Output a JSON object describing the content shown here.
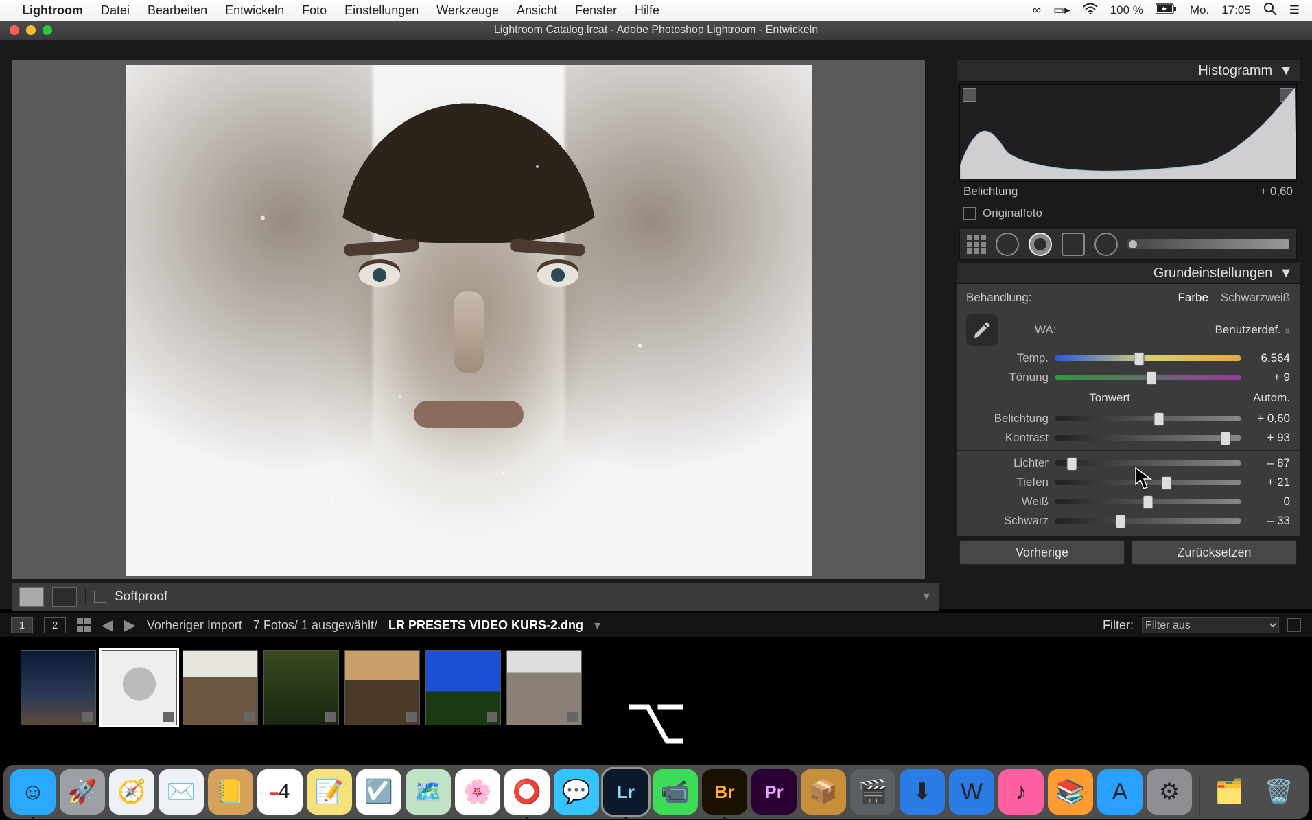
{
  "menubar": {
    "app": "Lightroom",
    "items": [
      "Datei",
      "Bearbeiten",
      "Entwickeln",
      "Foto",
      "Einstellungen",
      "Werkzeuge",
      "Ansicht",
      "Fenster",
      "Hilfe"
    ],
    "battery": "100 %",
    "day": "Mo.",
    "time": "17:05",
    "cc_icon": "creative-cloud",
    "airplay": "airplay",
    "wifi": "wifi",
    "search": "search",
    "menu": "menu"
  },
  "window": {
    "title": "Lightroom Catalog.lrcat - Adobe Photoshop Lightroom - Entwickeln"
  },
  "histogram": {
    "title": "Histogramm",
    "readout_label": "Belichtung",
    "readout_value": "+ 0,60",
    "original_label": "Originalfoto",
    "original_checked": false
  },
  "basic": {
    "title": "Grundeinstellungen",
    "treatment_label": "Behandlung:",
    "treatment_color": "Farbe",
    "treatment_bw": "Schwarzweiß",
    "treatment_selected": "Farbe",
    "wb_label": "WA:",
    "wb_value": "Benutzerdef.",
    "sliders": {
      "temp": {
        "label": "Temp.",
        "value": "6.564",
        "pos": 45
      },
      "tint": {
        "label": "Tönung",
        "value": "+ 9",
        "pos": 52
      },
      "tone_title": "Tonwert",
      "auto": "Autom.",
      "exposure": {
        "label": "Belichtung",
        "value": "+ 0,60",
        "pos": 56
      },
      "contrast": {
        "label": "Kontrast",
        "value": "+ 93",
        "pos": 92
      },
      "highlights": {
        "label": "Lichter",
        "value": "– 87",
        "pos": 9
      },
      "shadows": {
        "label": "Tiefen",
        "value": "+ 21",
        "pos": 60
      },
      "whites": {
        "label": "Weiß",
        "value": "0",
        "pos": 50
      },
      "blacks": {
        "label": "Schwarz",
        "value": "– 33",
        "pos": 35
      }
    },
    "prev_button": "Vorherige",
    "reset_button": "Zurücksetzen"
  },
  "under_toolbar": {
    "softproof": "Softproof"
  },
  "filmstrip_header": {
    "page1": "1",
    "page2": "2",
    "crumb_source": "Vorheriger Import",
    "crumb_count": "7 Fotos/  1 ausgewählt/",
    "filename": "LR PRESETS VIDEO KURS-2.dng",
    "filter_label": "Filter:",
    "filter_value": "Filter aus"
  },
  "dock": {
    "apps": [
      {
        "name": "finder",
        "color": "#2aa9ff",
        "glyph": "☺",
        "running": true
      },
      {
        "name": "launchpad",
        "color": "#9aa0a6",
        "glyph": "🚀"
      },
      {
        "name": "safari",
        "color": "#eef2f6",
        "glyph": "🧭"
      },
      {
        "name": "mail",
        "color": "#eef2f6",
        "glyph": "✉️"
      },
      {
        "name": "contacts",
        "color": "#d6a25b",
        "glyph": "📒"
      },
      {
        "name": "calendar",
        "color": "#fff",
        "glyph": "4"
      },
      {
        "name": "notes",
        "color": "#f6e27a",
        "glyph": "📝"
      },
      {
        "name": "reminders",
        "color": "#fff",
        "glyph": "☑️"
      },
      {
        "name": "maps",
        "color": "#bfe3c4",
        "glyph": "🗺️"
      },
      {
        "name": "photos",
        "color": "#fff",
        "glyph": "🌸"
      },
      {
        "name": "chrome",
        "color": "#fff",
        "glyph": "⭕",
        "running": true
      },
      {
        "name": "messages",
        "color": "#34c4ff",
        "glyph": "💬"
      },
      {
        "name": "lightroom",
        "color": "#0b1a2a",
        "glyph": "Lr",
        "running": true
      },
      {
        "name": "facetime",
        "color": "#3ddc58",
        "glyph": "📹"
      },
      {
        "name": "bridge",
        "color": "#1a1000",
        "glyph": "Br",
        "running": true
      },
      {
        "name": "premiere",
        "color": "#2b0033",
        "glyph": "Pr"
      },
      {
        "name": "pkg",
        "color": "#c88f3a",
        "glyph": "📦"
      },
      {
        "name": "imovie",
        "color": "#5a5f66",
        "glyph": "🎬"
      },
      {
        "name": "dropbox",
        "color": "#2a7be4",
        "glyph": "⬇︎"
      },
      {
        "name": "word",
        "color": "#2a7be4",
        "glyph": "W"
      },
      {
        "name": "itunes",
        "color": "#ff5ea0",
        "glyph": "♪"
      },
      {
        "name": "ibooks",
        "color": "#ff9b30",
        "glyph": "📚"
      },
      {
        "name": "appstore",
        "color": "#2aa0ff",
        "glyph": "A"
      },
      {
        "name": "preferences",
        "color": "#8e8e93",
        "glyph": "⚙︎"
      }
    ],
    "right": [
      {
        "name": "downloads",
        "glyph": "🗂️"
      },
      {
        "name": "trash",
        "glyph": "🗑️"
      }
    ]
  }
}
